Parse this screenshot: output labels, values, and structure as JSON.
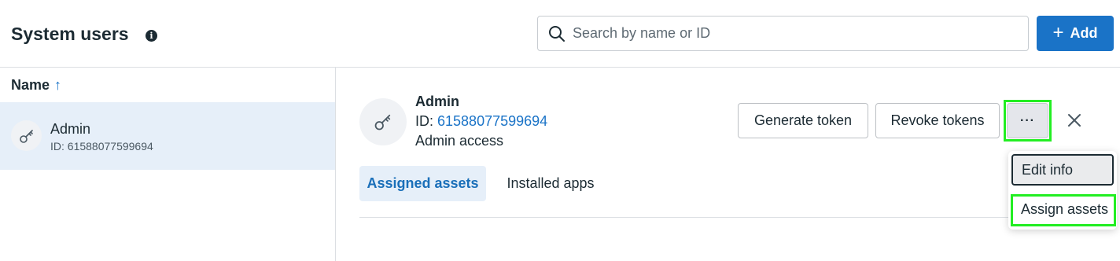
{
  "header": {
    "title": "System users",
    "search_placeholder": "Search by name or ID",
    "add_label": "Add"
  },
  "list": {
    "column_header": "Name",
    "sort": "ascending",
    "rows": [
      {
        "name": "Admin",
        "id_line": "ID: 61588077599694",
        "selected": true
      }
    ]
  },
  "detail": {
    "name": "Admin",
    "id_prefix": "ID: ",
    "id_value": "61588077599694",
    "access": "Admin access",
    "generate_token_label": "Generate token",
    "revoke_tokens_label": "Revoke tokens",
    "more_label": "···",
    "tabs": [
      {
        "label": "Assigned assets",
        "active": true
      },
      {
        "label": "Installed apps",
        "active": false
      }
    ]
  },
  "menu": {
    "items": [
      {
        "label": "Edit info"
      },
      {
        "label": "Assign assets"
      }
    ]
  },
  "colors": {
    "accent": "#1a73c7",
    "selected_row": "#e6eff9",
    "highlight": "#22ee22"
  },
  "icons": [
    "info-icon",
    "search-icon",
    "plus-icon",
    "sort-arrow-up-icon",
    "key-icon",
    "more-icon",
    "close-icon"
  ]
}
